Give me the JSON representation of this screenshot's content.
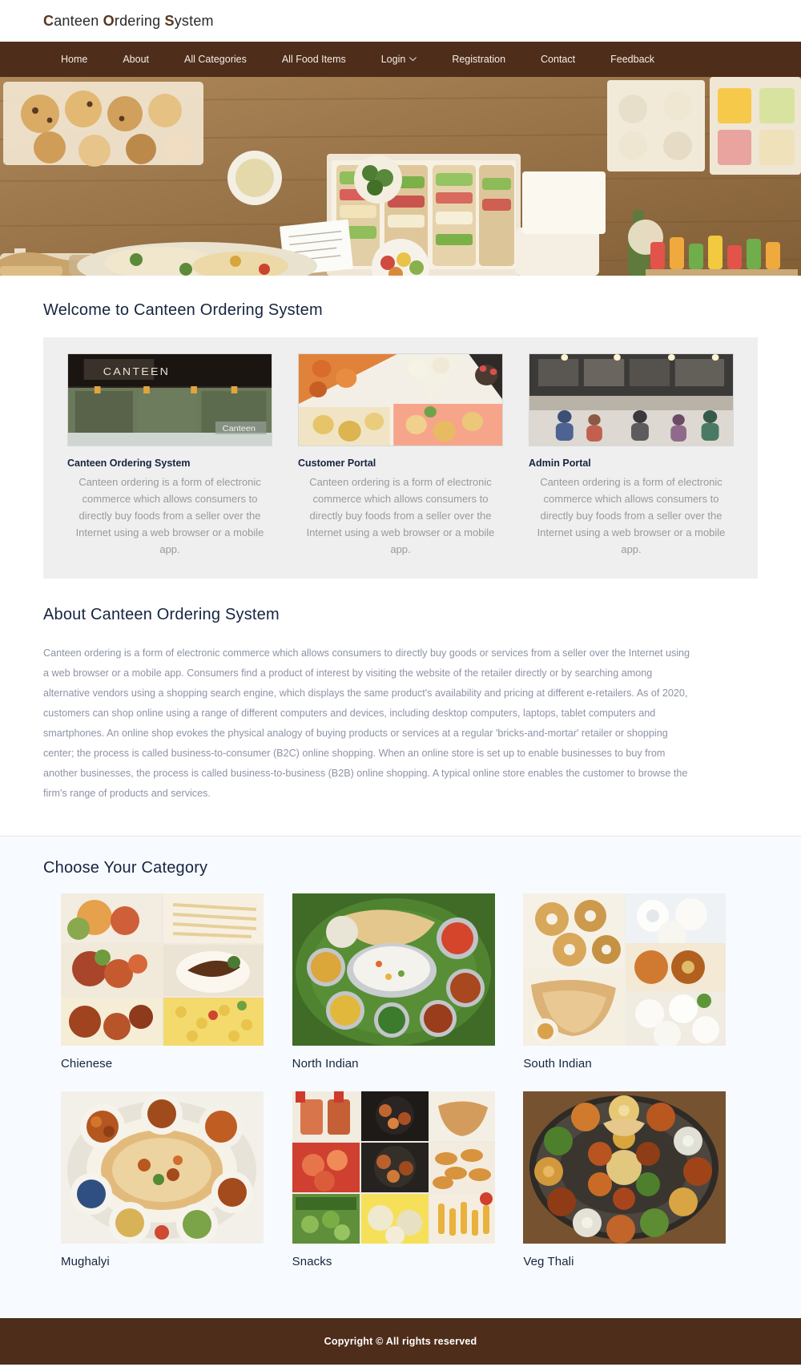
{
  "site": {
    "brand_full": "Canteen Ordering System",
    "brand_parts": [
      {
        "cap": "C",
        "rest": "anteen "
      },
      {
        "cap": "O",
        "rest": "rdering "
      },
      {
        "cap": "S",
        "rest": "ystem"
      }
    ],
    "accent_brown": "#4e2d1a",
    "accent_navy": "#16243f",
    "category_bg": "#f7fbff",
    "cards_bg": "#efefef"
  },
  "nav": {
    "items": [
      {
        "label": "Home",
        "has_caret": false
      },
      {
        "label": "About",
        "has_caret": false
      },
      {
        "label": "All Categories",
        "has_caret": false
      },
      {
        "label": "All Food Items",
        "has_caret": false
      },
      {
        "label": "Login",
        "has_caret": true,
        "caret": "⌄"
      },
      {
        "label": "Registration",
        "has_caret": false
      },
      {
        "label": "Contact",
        "has_caret": false
      },
      {
        "label": "Feedback",
        "has_caret": false
      }
    ]
  },
  "hero": {
    "alt": "assorted sandwiches, salads and desserts laid out on a wooden table"
  },
  "welcome": {
    "title": "Welcome to Canteen Ordering System",
    "cards": [
      {
        "title": "Canteen Ordering System",
        "text": "Canteen ordering is a form of electronic commerce which allows consumers to directly buy foods from a seller over the Internet using a web browser or a mobile app.",
        "image_alt": "canteen counter storefront with Canteen signage"
      },
      {
        "title": "Customer Portal",
        "text": "Canteen ordering is a form of electronic commerce which allows consumers to directly buy foods from a seller over the Internet using a web browser or a mobile app.",
        "image_alt": "collage of fried snacks, eggs, breads and desserts"
      },
      {
        "title": "Admin Portal",
        "text": "Canteen ordering is a form of electronic commerce which allows consumers to directly buy foods from a seller over the Internet using a web browser or a mobile app.",
        "image_alt": "food court interior with customers at the service counter"
      }
    ]
  },
  "about": {
    "title": "About Canteen Ordering System",
    "text": "Canteen ordering is a form of electronic commerce which allows consumers to directly buy goods or services from a seller over the Internet using a web browser or a mobile app. Consumers find a product of interest by visiting the website of the retailer directly or by searching among alternative vendors using a shopping search engine, which displays the same product's availability and pricing at different e-retailers. As of 2020, customers can shop online using a range of different computers and devices, including desktop computers, laptops, tablet computers and smartphones. An online shop evokes the physical analogy of buying products or services at a regular 'bricks-and-mortar' retailer or shopping center; the process is called business-to-consumer (B2C) online shopping. When an online store is set up to enable businesses to buy from another businesses, the process is called business-to-business (B2B) online shopping. A typical online store enables the customer to browse the firm's range of products and services."
  },
  "categories": {
    "title": "Choose Your Category",
    "items": [
      {
        "label": "Chienese",
        "image_alt": "collage of chinese dishes, noodles and fried rice"
      },
      {
        "label": "North Indian",
        "image_alt": "north indian thali with naan, rice and curries on a banana leaf"
      },
      {
        "label": "South Indian",
        "image_alt": "south indian vada, dosa, idli with chutney and sambar"
      },
      {
        "label": "Mughalyi",
        "image_alt": "mughlai platter of biryani, kebabs and curries"
      },
      {
        "label": "Snacks",
        "image_alt": "collage of fried snacks, wings, fries and pickles"
      },
      {
        "label": "Veg Thali",
        "image_alt": "large veg thali with many bowls of curries and sides"
      }
    ]
  },
  "footer": {
    "copyright": "Copyright © All rights reserved"
  }
}
